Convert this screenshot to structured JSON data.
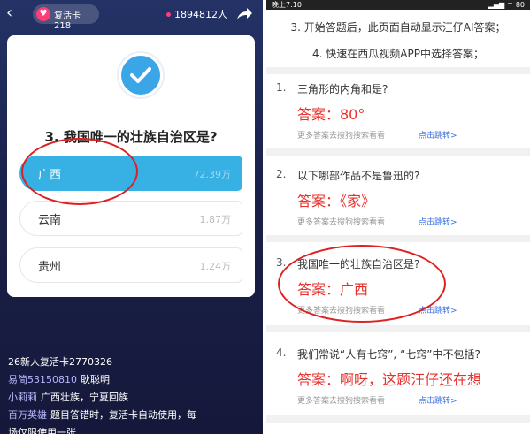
{
  "left": {
    "revive_card": "复活卡 218",
    "viewer_count": "1894812人",
    "question": "3. 我国唯一的壮族自治区是?",
    "options": [
      {
        "name": "广西",
        "count": "72.39万",
        "selected": true
      },
      {
        "name": "云南",
        "count": "1.87万",
        "selected": false
      },
      {
        "name": "贵州",
        "count": "1.24万",
        "selected": false
      }
    ],
    "feed": [
      {
        "nick": "",
        "text": "26新人复活卡2770326"
      },
      {
        "nick": "易简53150810",
        "text": "耿聪明"
      },
      {
        "nick": "小莉莉",
        "text": "广西壮族，宁夏回族"
      },
      {
        "nick": "百万英雄",
        "text": "题目答错时，复活卡自动使用，每"
      },
      {
        "nick": "",
        "text": "场仅限使用一张"
      }
    ]
  },
  "right": {
    "status_time": "晚上7:10",
    "status_icons": "▂▄▆ ⌔ 80",
    "instructions": [
      "3. 开始答题后，此页面自动显示汪仔AI答案；",
      "4. 快速在西瓜视频APP中选择答案；"
    ],
    "questions": [
      {
        "num": "1.",
        "text": "三角形的内角和是?",
        "answer": "答案：80°",
        "more": "更多答案去搜狗搜索看看",
        "link": "点击跳转>"
      },
      {
        "num": "2.",
        "text": "以下哪部作品不是鲁迅的?",
        "answer": "答案：《家》",
        "more": "更多答案去搜狗搜索看看",
        "link": "点击跳转>"
      },
      {
        "num": "3.",
        "text": "我国唯一的壮族自治区是?",
        "answer": "答案：广西",
        "more": "更多答案去搜狗搜索看看",
        "link": "点击跳转>"
      },
      {
        "num": "4.",
        "text": "我们常说“人有七窍”, “七窍”中不包括?",
        "answer": "答案：啊呀，这题汪仔还在想",
        "more": "更多答案去搜狗搜索看看",
        "link": "点击跳转>"
      }
    ]
  },
  "colors": {
    "accent_blue": "#37b1e4",
    "answer_red": "#e8302c",
    "link_blue": "#3b6fe0",
    "annotation_red": "#e02020"
  }
}
